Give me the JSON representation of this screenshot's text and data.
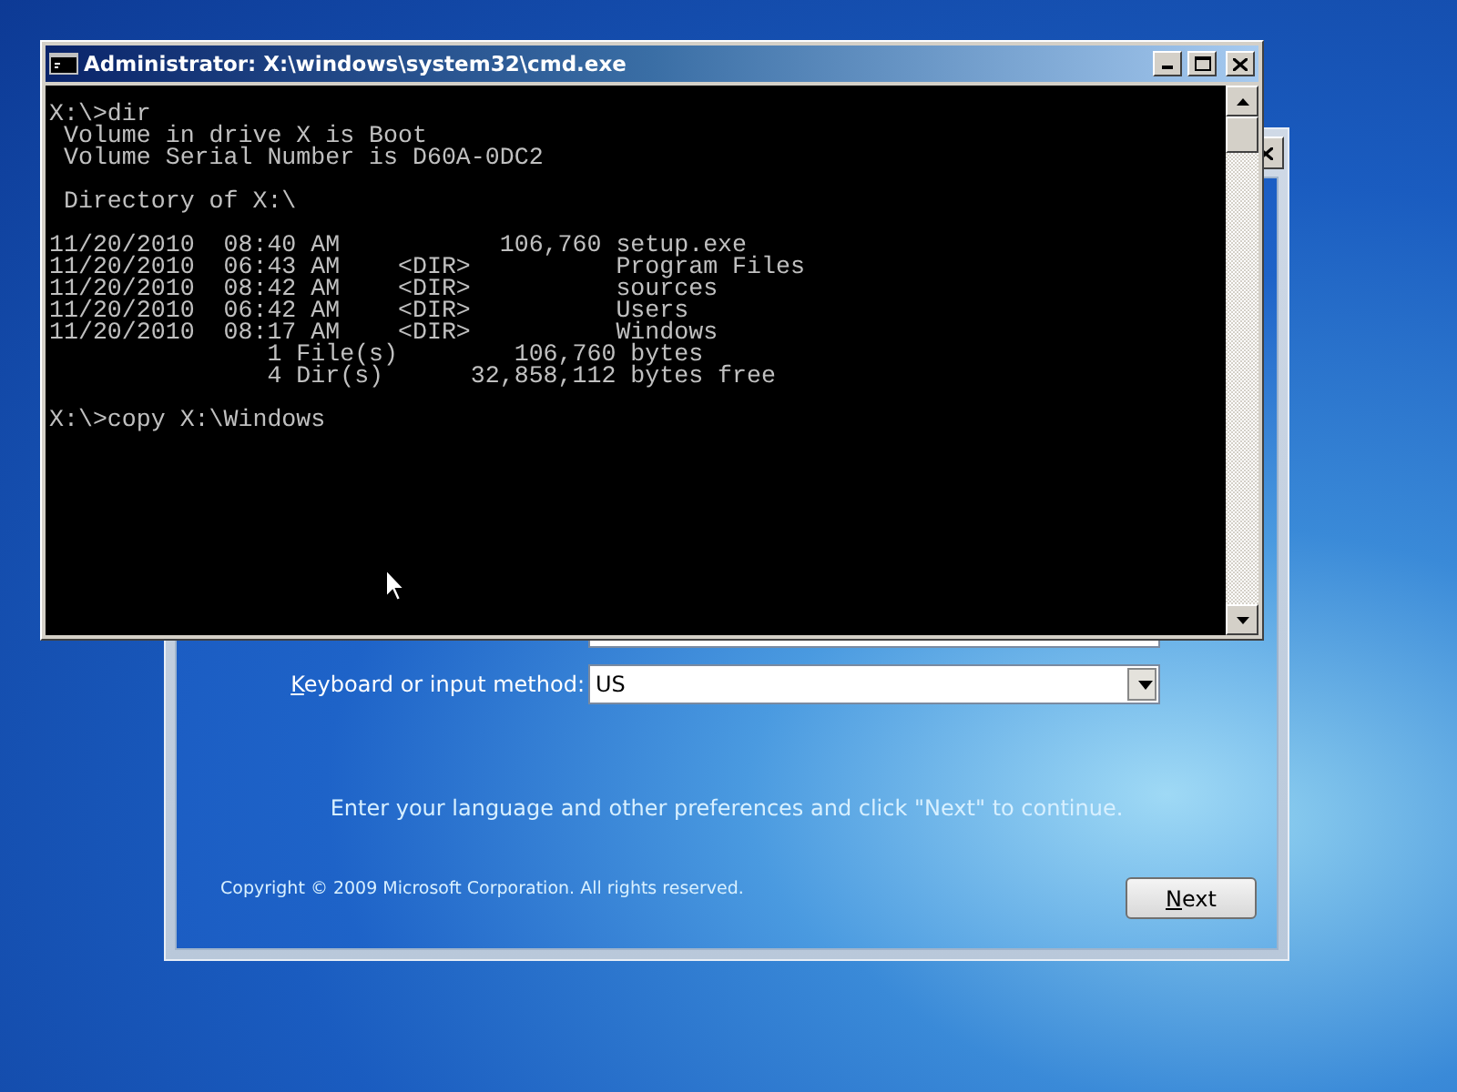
{
  "cmd_window": {
    "title": "Administrator: X:\\windows\\system32\\cmd.exe",
    "blocks": [
      [
        "X:\\>dir",
        " Volume in drive X is Boot",
        " Volume Serial Number is D60A-0DC2"
      ],
      [
        " Directory of X:\\"
      ],
      [
        "11/20/2010  08:40 AM           106,760 setup.exe",
        "11/20/2010  06:43 AM    <DIR>          Program Files",
        "11/20/2010  08:42 AM    <DIR>          sources",
        "11/20/2010  06:42 AM    <DIR>          Users",
        "11/20/2010  08:17 AM    <DIR>          Windows",
        "               1 File(s)        106,760 bytes",
        "               4 Dir(s)      32,858,112 bytes free"
      ],
      [
        "X:\\>copy X:\\Windows"
      ]
    ]
  },
  "setup_window": {
    "keyboard_label": "Keyboard or input method:",
    "keyboard_value": "US",
    "instruction": "Enter your language and other preferences and click \"Next\" to continue.",
    "copyright": "Copyright © 2009 Microsoft Corporation. All rights reserved.",
    "next_button": "Next"
  }
}
